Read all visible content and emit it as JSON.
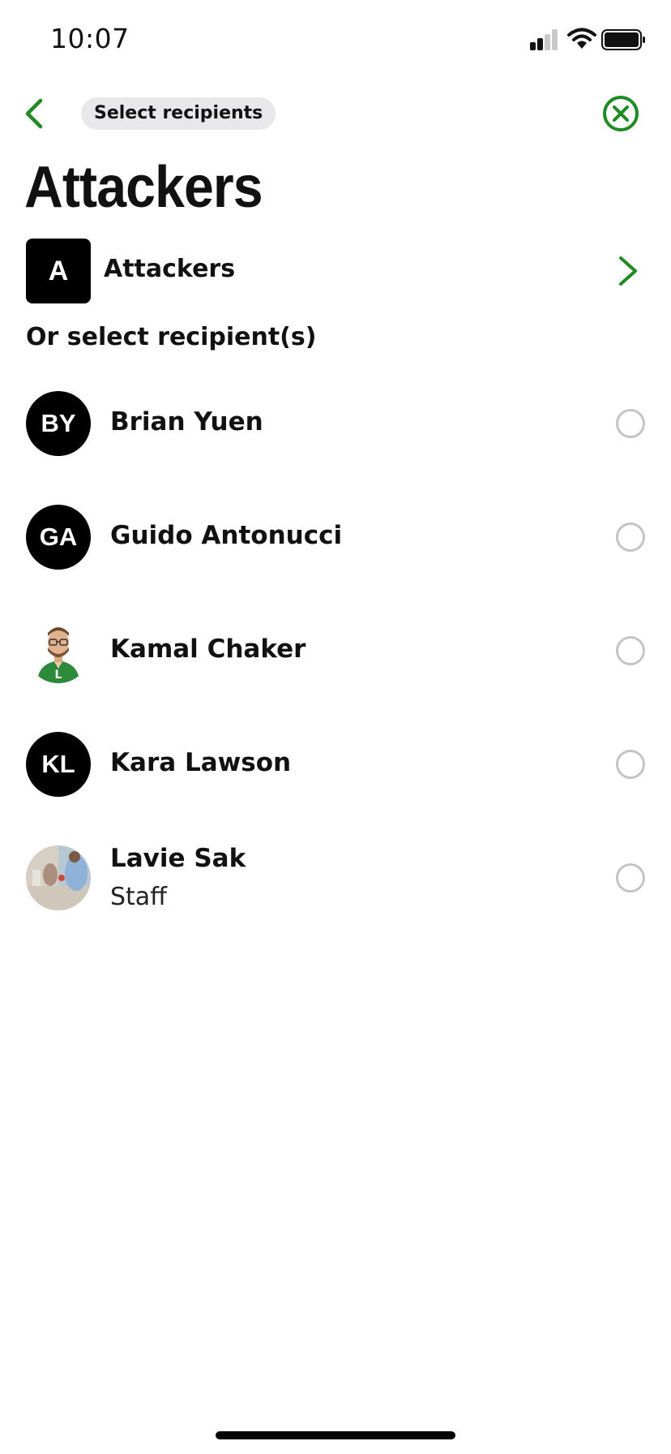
{
  "status_bar": {
    "time": "10:07"
  },
  "nav": {
    "pill_label": "Select recipients"
  },
  "page": {
    "title": "Attackers"
  },
  "group": {
    "initial": "A",
    "name": "Attackers"
  },
  "section_label": "Or select recipient(s)",
  "recipients": [
    {
      "initials": "BY",
      "name": "Brian Yuen",
      "subtitle": ""
    },
    {
      "initials": "GA",
      "name": "Guido Antonucci",
      "subtitle": ""
    },
    {
      "initials": "",
      "name": "Kamal Chaker",
      "subtitle": ""
    },
    {
      "initials": "KL",
      "name": "Kara Lawson",
      "subtitle": ""
    },
    {
      "initials": "",
      "name": "Lavie Sak",
      "subtitle": "Staff"
    }
  ],
  "colors": {
    "accent": "#1e8b24",
    "radio_border": "#c4c4c4",
    "avatar_bg": "#000000",
    "pill_bg": "#e8e8ea"
  }
}
